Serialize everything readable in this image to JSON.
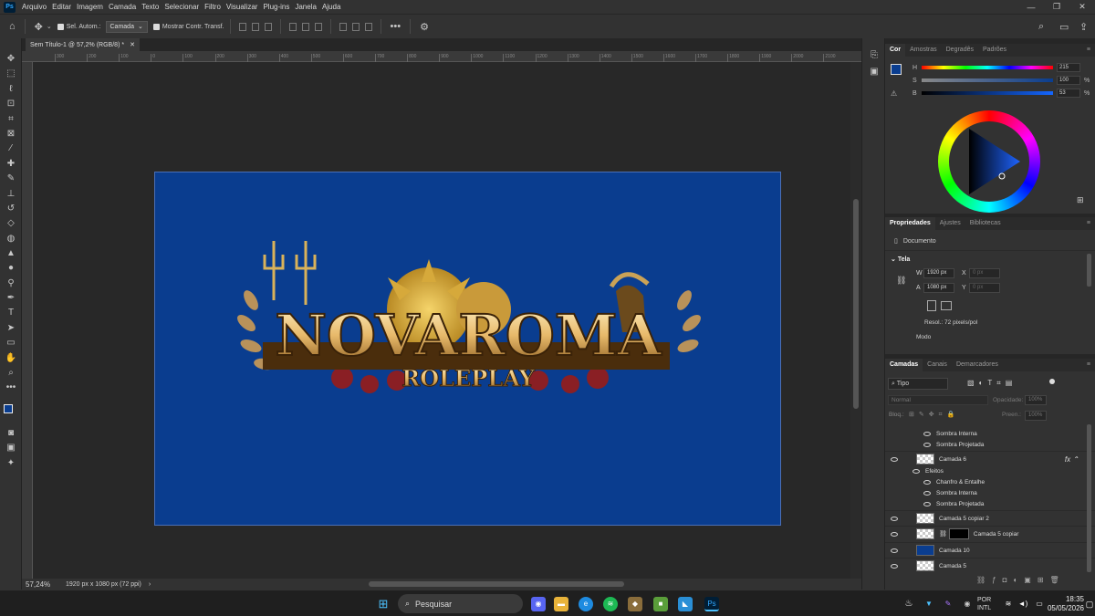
{
  "menubar": {
    "items": [
      "Arquivo",
      "Editar",
      "Imagem",
      "Camada",
      "Texto",
      "Selecionar",
      "Filtro",
      "Visualizar",
      "Plug-ins",
      "Janela",
      "Ajuda"
    ]
  },
  "options": {
    "auto_select_label": "Sel. Autom.:",
    "auto_select_value": "Camada",
    "show_transform_label": "Mostrar Contr. Transf."
  },
  "document": {
    "tab_title": "Sem Título-1 @ 57,2% (RGB/8) *",
    "zoom": "57,24%",
    "info": "1920 px x 1080 px (72 ppi)"
  },
  "ruler": [
    "300",
    "200",
    "100",
    "0",
    "100",
    "200",
    "300",
    "400",
    "500",
    "600",
    "700",
    "800",
    "900",
    "1000",
    "1100",
    "1200",
    "1300",
    "1400",
    "1500",
    "1600",
    "1700",
    "1800",
    "1900",
    "2000",
    "2100"
  ],
  "color_panel": {
    "tabs": [
      "Cor",
      "Amostras",
      "Degradês",
      "Padrões"
    ],
    "h_value": "215",
    "s_value": "100",
    "b_value": "53",
    "pct": "%"
  },
  "properties_panel": {
    "tabs": [
      "Propriedades",
      "Ajustes",
      "Bibliotecas"
    ],
    "doc_label": "Documento",
    "section": "Tela",
    "w_label": "W",
    "w_value": "1920 px",
    "h_label": "A",
    "h_value": "1080 px",
    "x_label": "X",
    "x_value": "0 px",
    "y_label": "Y",
    "y_value": "0 px",
    "resolution": "Resol.: 72 pixels/pol",
    "mode": "Modo"
  },
  "layers_panel": {
    "tabs": [
      "Camadas",
      "Canais",
      "Demarcadores"
    ],
    "filter": "Tipo",
    "blend": "Normal",
    "opacity_label": "Opacidade:",
    "opacity_value": "100%",
    "lock_label": "Bloq.:",
    "fill_label": "Preen.:",
    "fill_value": "100%",
    "effects_top": [
      "Sombra Interna",
      "Sombra Projetada"
    ],
    "layer6": "Camada 6",
    "effects_label": "Efeitos",
    "effects6": [
      "Chanfro & Entalhe",
      "Sombra Interna",
      "Sombra Projetada"
    ],
    "layers": [
      "Camada 5 copiar 2",
      "Camada 5 copiar",
      "Camada 10",
      "Camada 5"
    ]
  },
  "artwork": {
    "title_main": "NOVAROMA",
    "title_sub": "ROLEPLAY"
  },
  "taskbar": {
    "search": "Pesquisar",
    "lang1": "POR",
    "lang2": "INTL",
    "time": "18:35",
    "date": "05/05/2026"
  },
  "colors": {
    "foreground": "#0a3d8f",
    "canvas": "#0a3d8f"
  }
}
